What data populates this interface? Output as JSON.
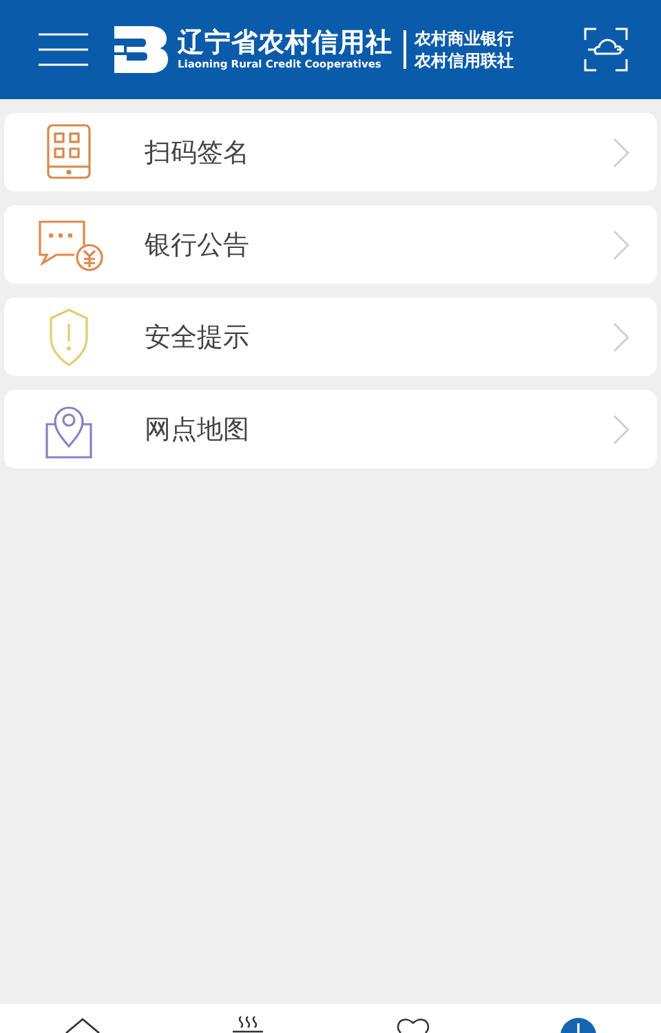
{
  "header": {
    "brand_name": "辽宁省农村信用社",
    "brand_subtitle": "Liaoning Rural Credit Cooperatives",
    "bank_lines": [
      "农村商业银行",
      "农村信用联社"
    ]
  },
  "menu": [
    {
      "kind": "scan",
      "label": "扫码签名"
    },
    {
      "kind": "notice",
      "label": "银行公告"
    },
    {
      "kind": "security",
      "label": "安全提示"
    },
    {
      "kind": "map",
      "label": "网点地图"
    }
  ],
  "tab_bar": [
    {
      "kind": "home"
    },
    {
      "kind": "steam"
    },
    {
      "kind": "heart"
    },
    {
      "kind": "profile"
    }
  ]
}
